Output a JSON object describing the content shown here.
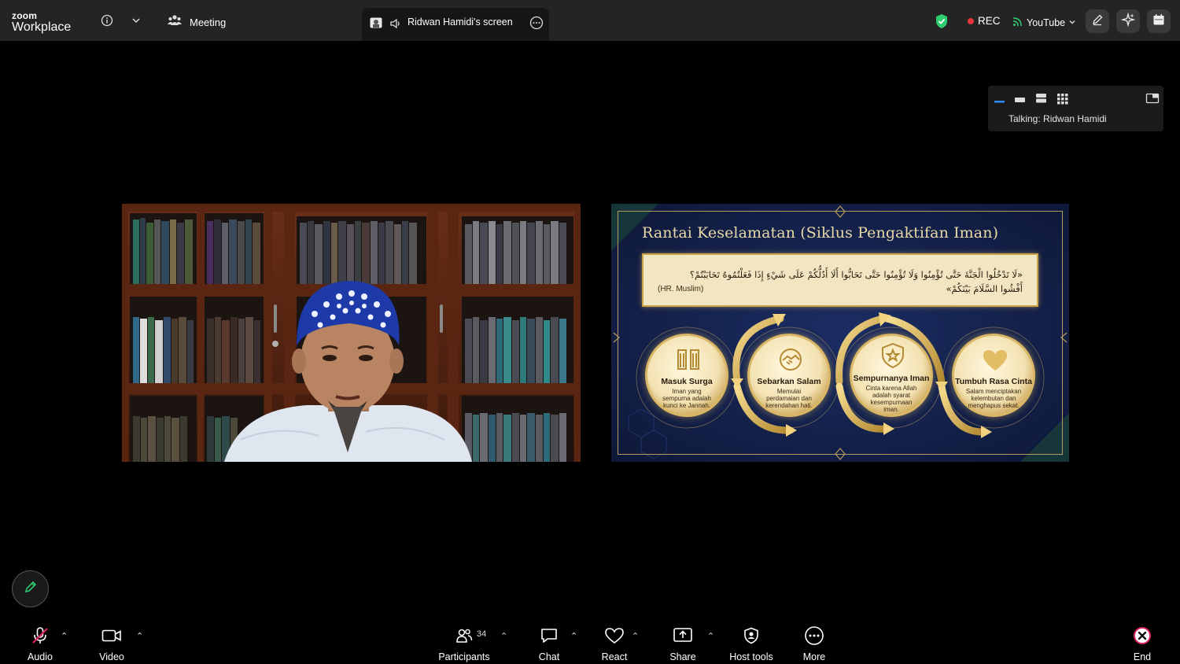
{
  "app": {
    "brand_small": "zoom",
    "brand_large": "Workplace"
  },
  "topbar": {
    "meeting_label": "Meeting",
    "screen_tab_label": "Ridwan Hamidi's screen",
    "rec_label": "REC",
    "stream_label": "YouTube"
  },
  "view_panel": {
    "talking": "Talking: Ridwan Hamidi"
  },
  "slide": {
    "title": "Rantai Keselamatan (Siklus Pengaktifan Iman)",
    "hadith_line1": "«لَا تَدْخُلُوا الْجَنَّةَ حَتَّى تُؤْمِنُوا وَلَا تُؤْمِنُوا حَتَّى تَحَابُّوا أَلَا أَدُلُّكُمْ عَلَى شَيْءٍ إِذَا فَعَلْتُمُوهُ تَحَابَبْتُمْ؟",
    "hadith_line2": "أَفْشُوا السَّلَامَ بَيْنَكُمْ»",
    "source": "(HR. Muslim)",
    "medallions": [
      {
        "title": "Masuk Surga",
        "desc": "Iman yang sempurna adalah kunci ke Jannah."
      },
      {
        "title": "Sebarkan Salam",
        "desc": "Memulai perdamaian dan kerendahan hati."
      },
      {
        "title": "Sempurnanya Iman",
        "desc": "Cinta karena Allah adalah syarat kesempurnaan iman."
      },
      {
        "title": "Tumbuh Rasa Cinta",
        "desc": "Salam menciptakan kelembutan dan menghapus sekat."
      }
    ]
  },
  "toolbar": {
    "audio": "Audio",
    "video": "Video",
    "participants": "Participants",
    "participants_count": "34",
    "chat": "Chat",
    "react": "React",
    "share": "Share",
    "host_tools": "Host tools",
    "more": "More",
    "end": "End"
  },
  "colors": {
    "accent_green": "#2ecc71",
    "rec_red": "#e8353a",
    "end_red": "#e0245e",
    "slide_gold": "#d9b766",
    "slide_navy": "#13204a"
  },
  "icons": [
    "info-icon",
    "chevron-down-icon",
    "meeting-people-icon",
    "speaker-icon",
    "more-circle-icon",
    "shield-check-icon",
    "broadcast-icon",
    "annotate-pen-icon",
    "ai-sparkle-icon",
    "calendar-icon",
    "mic-muted-icon",
    "camera-icon",
    "participants-icon",
    "chat-bubble-icon",
    "heart-icon",
    "share-screen-icon",
    "host-shield-icon",
    "ellipsis-icon",
    "end-x-icon"
  ]
}
